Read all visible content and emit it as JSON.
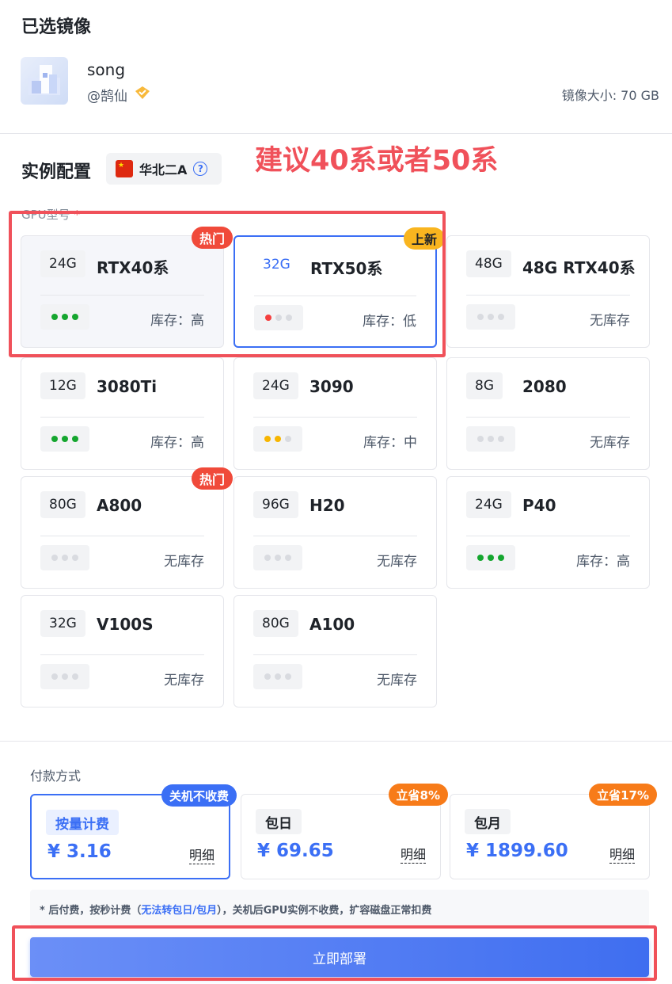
{
  "selected_image": {
    "section_title": "已选镜像",
    "name": "song",
    "author": "@鹄仙",
    "size_label": "镜像大小: 70 GB"
  },
  "instance_config": {
    "section_title": "实例配置",
    "region": "华北二A",
    "annotation": "建议40系或者50系",
    "gpu_label": "GPU型号",
    "gpu_required_mark": "*",
    "gpus": [
      {
        "mem": "24G",
        "name": "RTX40系",
        "stock": "库存：高",
        "badge": "热门"
      },
      {
        "mem": "32G",
        "name": "RTX50系",
        "stock": "库存：低",
        "badge": "上新"
      },
      {
        "mem": "48G",
        "name": "48G RTX40系",
        "stock": "无库存",
        "badge": ""
      },
      {
        "mem": "12G",
        "name": "3080Ti",
        "stock": "库存：高",
        "badge": ""
      },
      {
        "mem": "24G",
        "name": "3090",
        "stock": "库存：中",
        "badge": ""
      },
      {
        "mem": "8G",
        "name": "2080",
        "stock": "无库存",
        "badge": ""
      },
      {
        "mem": "80G",
        "name": "A800",
        "stock": "无库存",
        "badge": "热门"
      },
      {
        "mem": "96G",
        "name": "H20",
        "stock": "无库存",
        "badge": ""
      },
      {
        "mem": "24G",
        "name": "P40",
        "stock": "库存：高",
        "badge": ""
      },
      {
        "mem": "32G",
        "name": "V100S",
        "stock": "无库存",
        "badge": ""
      },
      {
        "mem": "80G",
        "name": "A100",
        "stock": "无库存",
        "badge": ""
      }
    ]
  },
  "payment": {
    "title": "付款方式",
    "options": [
      {
        "mode": "按量计费",
        "price": "¥ 3.16",
        "detail": "明细",
        "badge": "关机不收费"
      },
      {
        "mode": "包日",
        "price": "¥ 69.65",
        "detail": "明细",
        "badge": "立省8%"
      },
      {
        "mode": "包月",
        "price": "¥ 1899.60",
        "detail": "明细",
        "badge": "立省17%"
      }
    ],
    "note_prefix": "* 后付费，按秒计费（",
    "note_link": "无法转包日/包月",
    "note_suffix": "），关机后GPU实例不收费，扩容磁盘正常扣费"
  },
  "deploy_button": "立即部署",
  "colors": {
    "accent": "#3b6ff5",
    "hot": "#f04a3a",
    "annotation": "#f0515a"
  }
}
